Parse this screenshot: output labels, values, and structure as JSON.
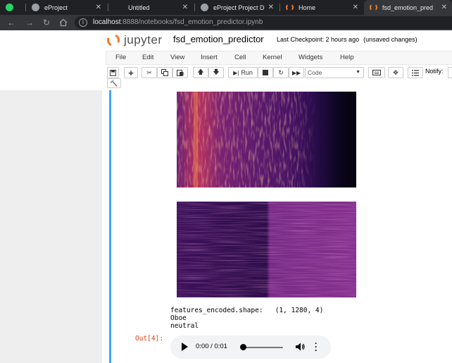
{
  "browser": {
    "tabs": [
      {
        "label": "",
        "icon": "whatsapp-icon",
        "color": "#25d366"
      },
      {
        "label": "eProject",
        "icon": "globe-icon",
        "color": "#9aa0a6"
      },
      {
        "label": "Untitled",
        "icon": "",
        "color": ""
      },
      {
        "label": "eProject Project D",
        "icon": "globe-icon",
        "color": "#9aa0a6"
      },
      {
        "label": "Home",
        "icon": "jupyter-icon",
        "color": "#f37726"
      },
      {
        "label": "fsd_emotion_pred",
        "icon": "jupyter-icon",
        "color": "#f37726"
      }
    ],
    "close_glyph": "✕",
    "url_host": "localhost",
    "url_rest": ":8888/notebooks/fsd_emotion_predictor.ipynb"
  },
  "jupyter": {
    "logo_text": "jupyter",
    "notebook_name": "fsd_emotion_predictor",
    "checkpoint": "Last Checkpoint: 2 hours ago",
    "unsaved": "(unsaved changes)",
    "menu": [
      "File",
      "Edit",
      "View",
      "Insert",
      "Cell",
      "Kernel",
      "Widgets",
      "Help"
    ],
    "run_label": "Run",
    "cell_type": "Code",
    "notify_label": "Notify:"
  },
  "output": {
    "shape_line": "features_encoded.shape:   (1, 1280, 4)",
    "instrument": "Oboe",
    "emotion": "neutral",
    "prompt": "Out[4]:",
    "audio_time": "0:00 / 0:01"
  },
  "colors": {
    "accent": "#42a5f5",
    "prompt": "#d84315",
    "jupyter_orange": "#f37726"
  }
}
